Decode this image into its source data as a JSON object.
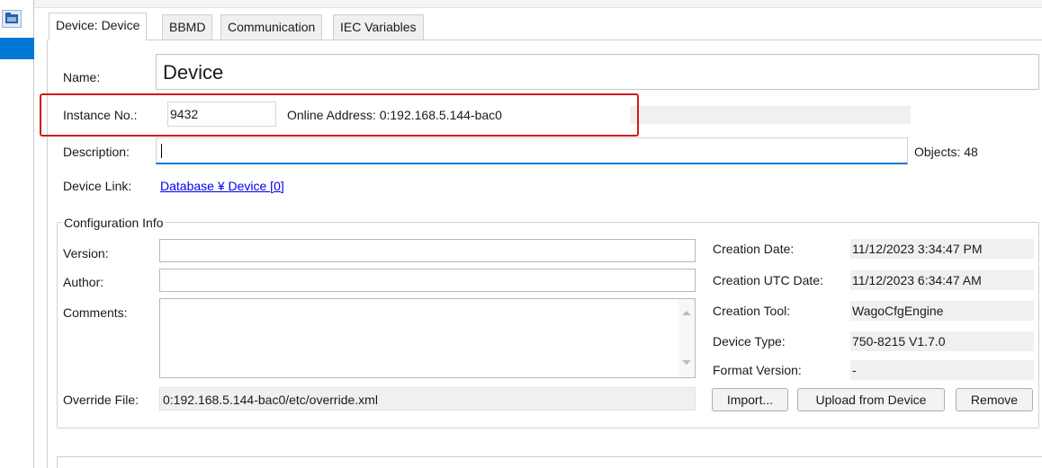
{
  "tabs": [
    {
      "label": "Device: Device"
    },
    {
      "label": "BBMD"
    },
    {
      "label": "Communication"
    },
    {
      "label": "IEC Variables"
    }
  ],
  "device": {
    "name_label": "Name:",
    "name_value": "Device",
    "instance_label": "Instance No.:",
    "instance_value": "9432",
    "online_label": "Online Address: 0:192.168.5.144-bac0",
    "description_label": "Description:",
    "description_value": "",
    "objects_label": "Objects: 48",
    "link_label": "Device Link:",
    "link_value": "Database ¥ Device [0]"
  },
  "config": {
    "group_label": "Configuration Info",
    "version_label": "Version:",
    "author_label": "Author:",
    "comments_label": "Comments:",
    "override_label": "Override File:",
    "override_value": "0:192.168.5.144-bac0/etc/override.xml",
    "creation_date_label": "Creation Date:",
    "creation_date_value": "11/12/2023 3:34:47 PM",
    "creation_utc_label": "Creation UTC Date:",
    "creation_utc_value": "11/12/2023 6:34:47 AM",
    "creation_tool_label": "Creation Tool:",
    "creation_tool_value": "WagoCfgEngine",
    "device_type_label": "Device Type:",
    "device_type_value": "750-8215 V1.7.0",
    "format_version_label": "Format Version:",
    "format_version_value": "-"
  },
  "buttons": {
    "import": "Import...",
    "upload": "Upload from Device",
    "remove": "Remove"
  },
  "icons": {
    "folder": "folder-icon",
    "scroll_up": "scroll-up-icon",
    "scroll_down": "scroll-down-icon"
  },
  "colors": {
    "highlight": "#d11a1a",
    "link": "#0000ee",
    "focus_underline": "#0078d7",
    "side_tab": "#0078d7"
  }
}
